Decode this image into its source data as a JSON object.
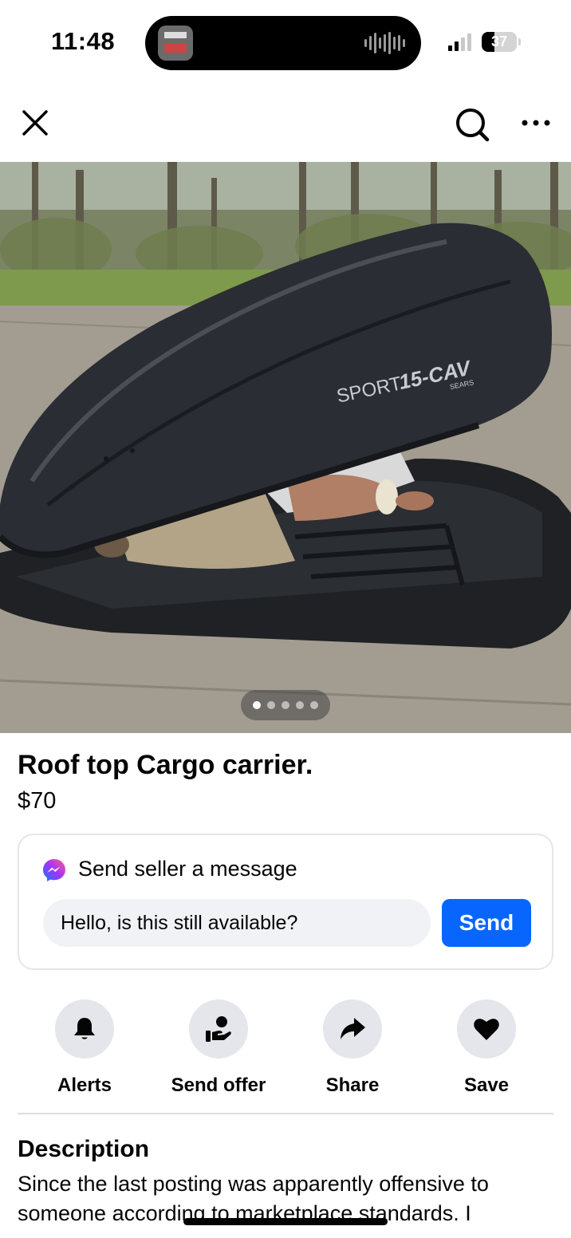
{
  "status_bar": {
    "time": "11:48",
    "battery_level": "37",
    "signal_bars_active": 2,
    "signal_bars_total": 4
  },
  "nav": {
    "close_icon": "close-icon",
    "search_icon": "search-icon",
    "more_icon": "more-horizontal-icon"
  },
  "photo": {
    "box_text_brand": "SPORT",
    "box_text_model": "15-CAV",
    "box_text_maker": "SEARS",
    "image_count": 5,
    "active_index": 0
  },
  "listing": {
    "title": "Roof top Cargo carrier.",
    "price": "$70"
  },
  "message": {
    "heading": "Send seller a message",
    "input_value": "Hello, is this still available?",
    "send_label": "Send"
  },
  "actions": [
    {
      "label": "Alerts",
      "icon": "bell-icon"
    },
    {
      "label": "Send offer",
      "icon": "offer-hand-icon"
    },
    {
      "label": "Share",
      "icon": "share-arrow-icon"
    },
    {
      "label": "Save",
      "icon": "heart-icon"
    }
  ],
  "description": {
    "title": "Description",
    "text": "Since the last posting was apparently offensive to someone according to marketplace standards. I"
  },
  "colors": {
    "accent": "#0866ff",
    "text": "#050505",
    "button_bg": "#e4e6eb",
    "input_bg": "#f0f2f5"
  }
}
